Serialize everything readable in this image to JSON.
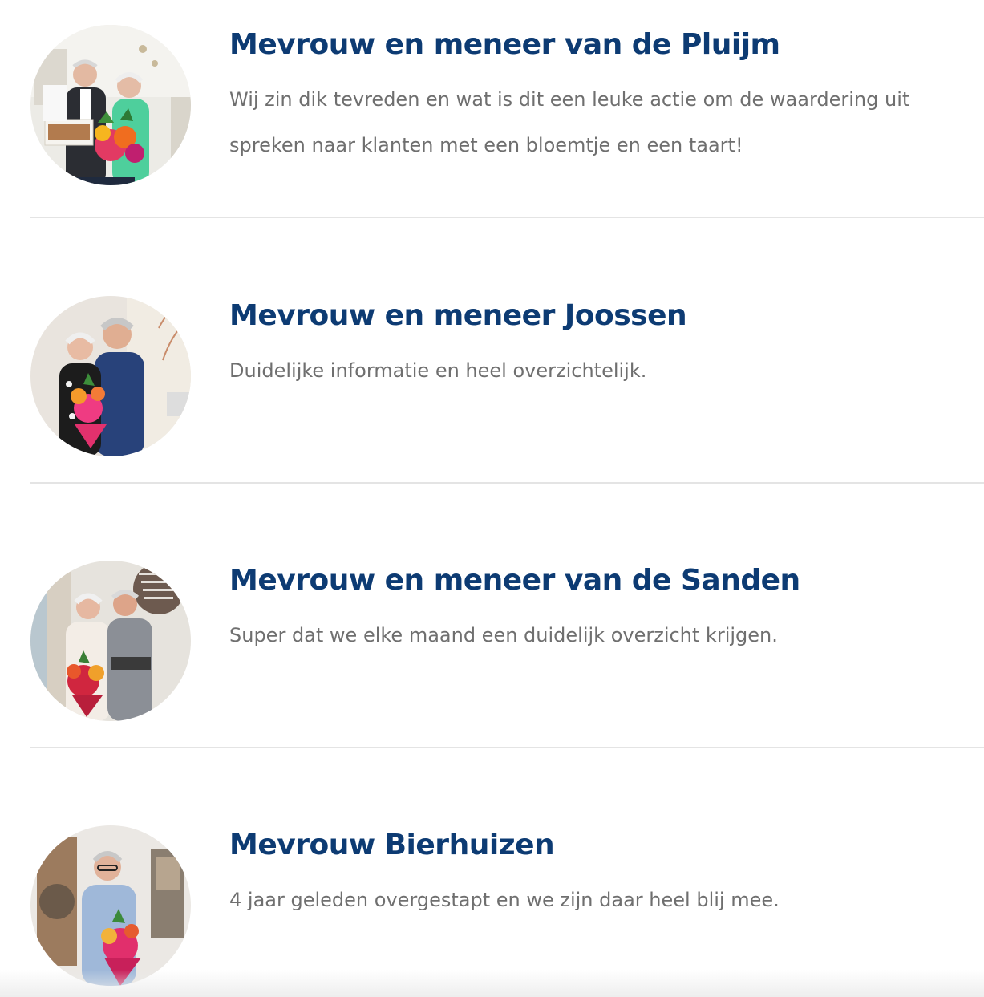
{
  "colors": {
    "title": "#0d3b73",
    "text": "#6f6f6f",
    "divider": "#e4e4e4"
  },
  "testimonials": [
    {
      "name": "Mevrouw en meneer van de Pluijm",
      "quote": "Wij zin dik tevreden en wat is dit een leuke actie om de waardering uit spreken naar klanten met een bloemtje en een taart!",
      "photo_icon": "couple-with-flowers-and-cake-photo"
    },
    {
      "name": "Mevrouw en meneer Joossen",
      "quote": "Duidelijke informatie en heel overzichtelijk.",
      "photo_icon": "couple-with-flowers-photo"
    },
    {
      "name": "Mevrouw en meneer van de Sanden",
      "quote": "Super dat we elke maand een duidelijk overzicht krijgen.",
      "photo_icon": "couple-with-flowers-and-gift-photo"
    },
    {
      "name": "Mevrouw Bierhuizen",
      "quote": "4 jaar geleden overgestapt en we zijn daar heel blij mee.",
      "photo_icon": "woman-with-flowers-photo"
    }
  ]
}
